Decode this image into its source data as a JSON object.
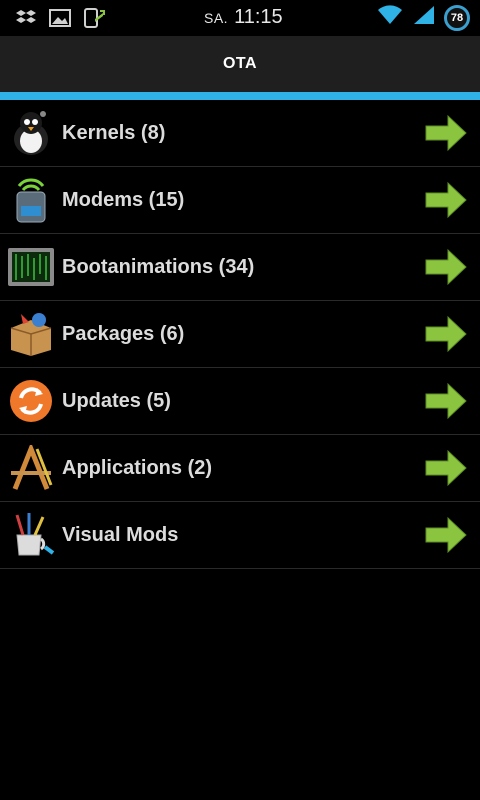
{
  "status_bar": {
    "day": "SA.",
    "time": "11:15",
    "battery_level": "78",
    "icons": [
      "dropbox-icon",
      "gallery-icon",
      "upload-icon",
      "wifi-icon",
      "signal-icon",
      "battery-icon"
    ],
    "accent_color": "#2fb2e5"
  },
  "action_bar": {
    "title": "OTA"
  },
  "list": {
    "items": [
      {
        "label": "Kernels (8)",
        "icon": "penguin-icon"
      },
      {
        "label": "Modems (15)",
        "icon": "modem-icon"
      },
      {
        "label": "Bootanimations (34)",
        "icon": "monitor-icon"
      },
      {
        "label": "Packages (6)",
        "icon": "package-icon"
      },
      {
        "label": "Updates (5)",
        "icon": "refresh-icon"
      },
      {
        "label": "Applications (2)",
        "icon": "applications-icon"
      },
      {
        "label": "Visual Mods",
        "icon": "brushes-icon"
      }
    ],
    "arrow_color": "#8bc53f"
  }
}
